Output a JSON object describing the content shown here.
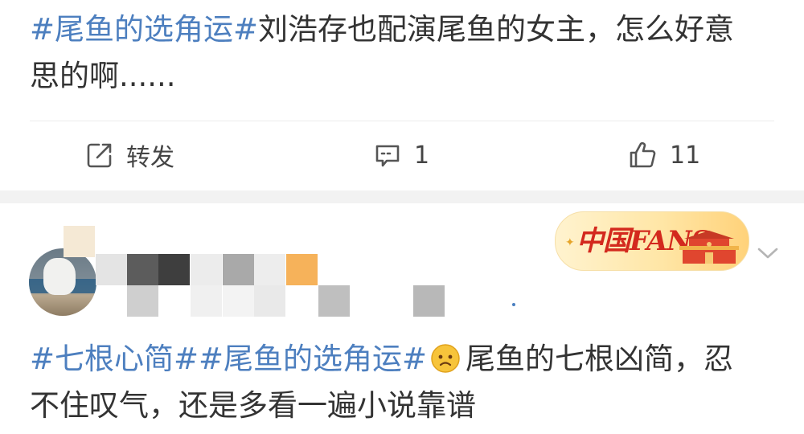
{
  "post1": {
    "tag": "#尾鱼的选角运#",
    "body_line1": "刘浩存也配演尾鱼的女主，怎么好意",
    "body_line2": "思的啊......",
    "actions": {
      "repost_label": "转发",
      "comment_count": "1",
      "like_count": "11"
    }
  },
  "post2": {
    "badge_text": "中国FANS",
    "tag1": "#七根心简#",
    "tag2": "#尾鱼的选角运#",
    "body_line1": "尾鱼的七根凶简，忍",
    "body_line2": "不住叹气，还是多看一遍小说靠谱",
    "mosaic_colors": [
      "#f5e9d5",
      "#e4e4e4",
      "#5c5c5c",
      "#3e3e3e",
      "#ececec",
      "#a9a9a9",
      "#ededed",
      "#f6b25a",
      "#cfcfcf",
      "#f0f0f0",
      "#b8b8b8",
      "#bfbfbf",
      "#cdcdcd"
    ]
  },
  "colors": {
    "tag": "#4d7fbf",
    "text": "#333333",
    "separator": "#f2f2f2",
    "badge_red": "#d3291e"
  },
  "icons": [
    "share-icon",
    "comment-icon",
    "thumbs-up-icon",
    "chevron-down-icon",
    "face-emoji-icon"
  ]
}
